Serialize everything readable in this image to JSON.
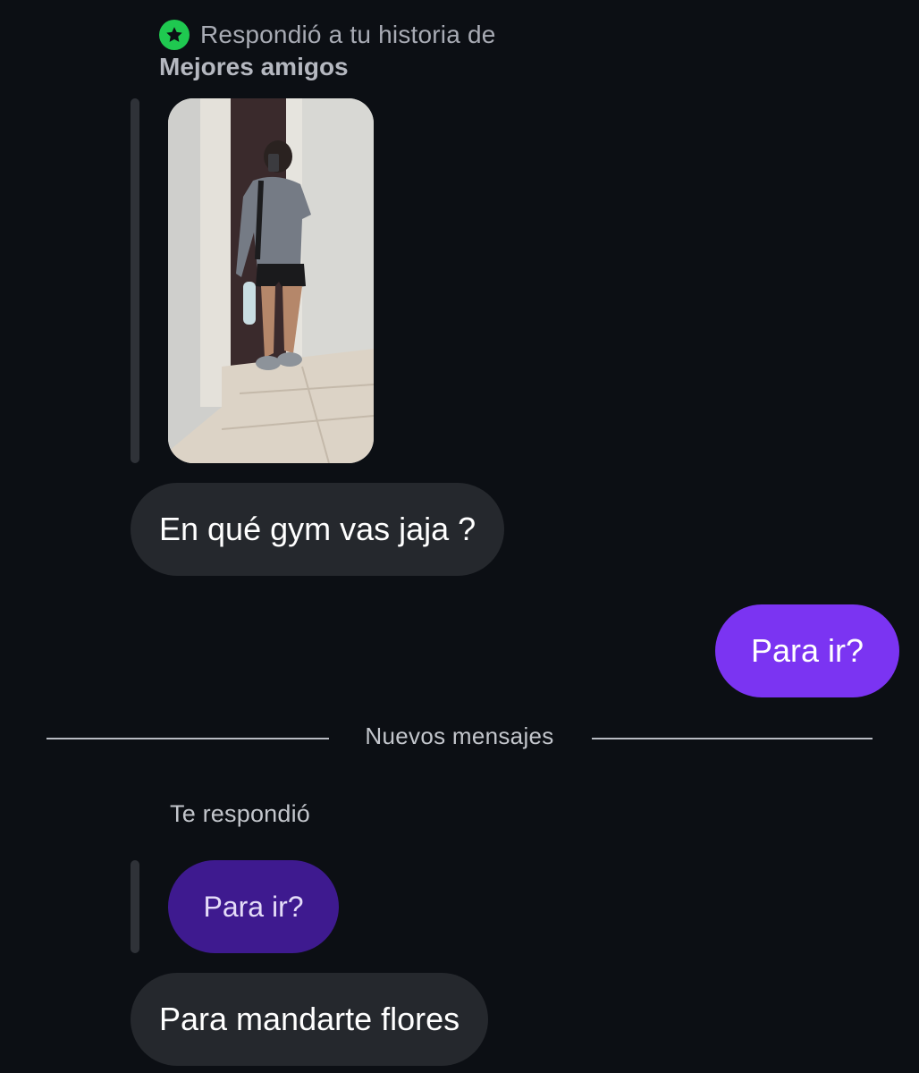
{
  "story_reply": {
    "prefix": "Respondió a tu historia de",
    "audience": "Mejores amigos",
    "badge_icon": "star-icon",
    "badge_color": "#1fc950"
  },
  "messages": {
    "received_1": "En qué gym vas jaja ?",
    "sent_1": "Para ir?",
    "reply_label": "Te respondió",
    "quoted_reply": "Para ir?",
    "received_2": "Para mandarte flores"
  },
  "divider": {
    "label": "Nuevos mensajes"
  },
  "colors": {
    "background": "#0c0f14",
    "received_bubble": "#25282d",
    "sent_bubble": "#7b34f2",
    "quoted_bubble": "#3e1a8f"
  }
}
